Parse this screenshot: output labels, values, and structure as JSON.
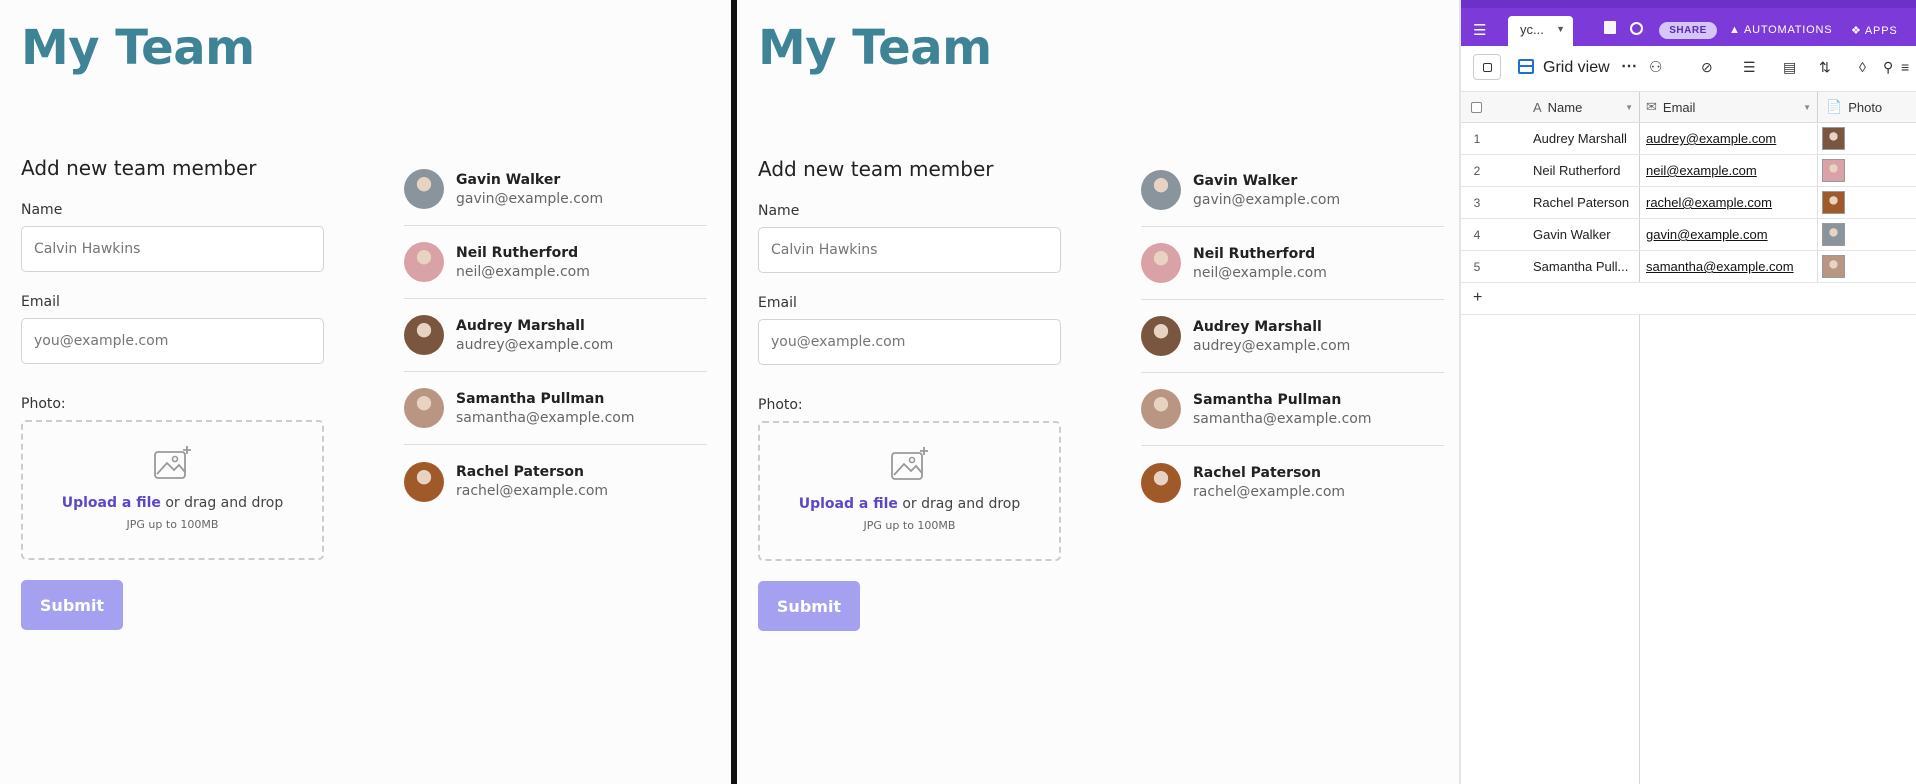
{
  "app": {
    "title": "My Team",
    "form": {
      "heading": "Add new team member",
      "name_label": "Name",
      "name_placeholder": "Calvin Hawkins",
      "email_label": "Email",
      "email_placeholder": "you@example.com",
      "photo_label": "Photo:",
      "upload_link": "Upload a file",
      "upload_text": " or drag and drop",
      "upload_hint": "JPG up to 100MB",
      "submit_label": "Submit"
    },
    "members": [
      {
        "name": "Gavin Walker",
        "email": "gavin@example.com",
        "avatar_color": "#8a949c"
      },
      {
        "name": "Neil Rutherford",
        "email": "neil@example.com",
        "avatar_color": "#d9a2a6"
      },
      {
        "name": "Audrey Marshall",
        "email": "audrey@example.com",
        "avatar_color": "#7a5640"
      },
      {
        "name": "Samantha Pullman",
        "email": "samantha@example.com",
        "avatar_color": "#b89682"
      },
      {
        "name": "Rachel Paterson",
        "email": "rachel@example.com",
        "avatar_color": "#a05a2a"
      }
    ]
  },
  "airtable": {
    "tab_label": "yc...",
    "share_label": "SHARE",
    "automations_label": "AUTOMATIONS",
    "apps_label": "APPS",
    "view_label": "Grid view",
    "columns": {
      "name": "Name",
      "email": "Email",
      "photo": "Photo"
    },
    "rows": [
      {
        "num": "1",
        "name": "Audrey Marshall",
        "email": "audrey@example.com",
        "photo_color": "#7a5640"
      },
      {
        "num": "2",
        "name": "Neil Rutherford",
        "email": "neil@example.com",
        "photo_color": "#d9a2a6"
      },
      {
        "num": "3",
        "name": "Rachel Paterson",
        "email": "rachel@example.com",
        "photo_color": "#a05a2a"
      },
      {
        "num": "4",
        "name": "Gavin Walker",
        "email": "gavin@example.com",
        "photo_color": "#8a949c"
      },
      {
        "num": "5",
        "name": "Samantha Pull...",
        "email": "samantha@example.com",
        "photo_color": "#b89682"
      }
    ],
    "add_row": "+",
    "brand_color": "#7c3bd9"
  }
}
